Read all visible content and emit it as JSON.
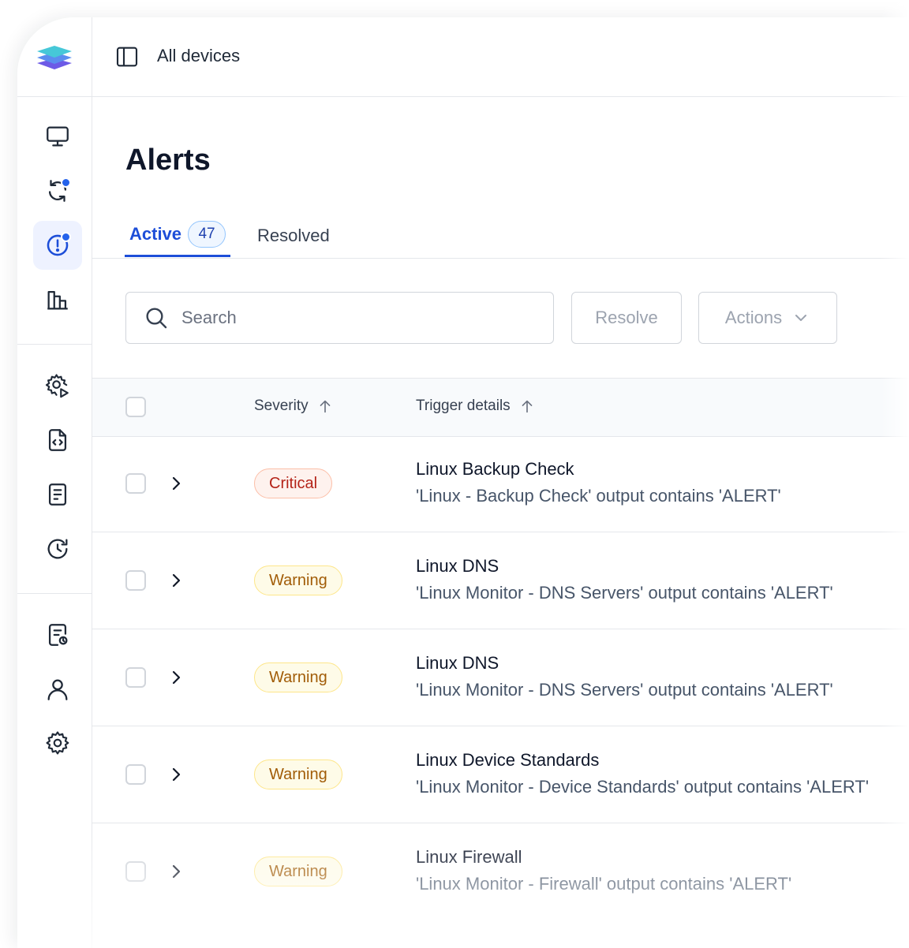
{
  "header": {
    "title": "All devices"
  },
  "page": {
    "title": "Alerts"
  },
  "tabs": [
    {
      "label": "Active",
      "count": "47"
    },
    {
      "label": "Resolved"
    }
  ],
  "toolbar": {
    "search_placeholder": "Search",
    "resolve_label": "Resolve",
    "actions_label": "Actions"
  },
  "table": {
    "columns": [
      "Severity",
      "Trigger details"
    ],
    "rows": [
      {
        "severity": "Critical",
        "title": "Linux Backup Check",
        "detail": "'Linux - Backup Check' output contains 'ALERT'"
      },
      {
        "severity": "Warning",
        "title": "Linux DNS",
        "detail": "'Linux Monitor - DNS Servers' output contains 'ALERT'"
      },
      {
        "severity": "Warning",
        "title": "Linux DNS",
        "detail": "'Linux Monitor - DNS Servers' output contains 'ALERT'"
      },
      {
        "severity": "Warning",
        "title": "Linux Device Standards",
        "detail": "'Linux Monitor - Device Standards' output contains 'ALERT'"
      },
      {
        "severity": "Warning",
        "title": "Linux Firewall",
        "detail": "'Linux Monitor - Firewall' output contains 'ALERT'"
      }
    ]
  },
  "sidebar": {
    "icons": [
      "monitor-icon",
      "sync-icon",
      "alert-icon",
      "bar-chart-icon",
      "automation-gear-icon",
      "script-file-icon",
      "document-icon",
      "history-icon",
      "report-icon",
      "user-icon",
      "settings-icon"
    ],
    "active": "alert-icon"
  },
  "colors": {
    "accent": "#1d4ed8",
    "critical_text": "#b42318",
    "critical_bg": "#fef2ee",
    "warning_text": "#a15c07",
    "warning_bg": "#fefbe8"
  }
}
